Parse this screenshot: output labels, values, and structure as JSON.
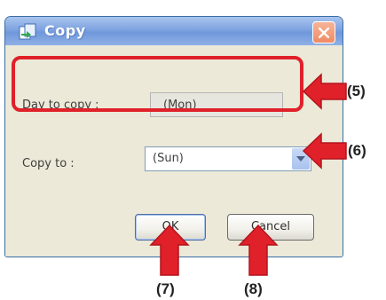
{
  "dialog": {
    "title": "Copy",
    "day_to_copy_label": "Day to copy :",
    "day_to_copy_value": "(Mon)",
    "copy_to_label": "Copy to :",
    "copy_to_value": "(Sun)",
    "ok_label": "OK",
    "cancel_label": "Cancel"
  },
  "callouts": {
    "c5": "(5)",
    "c6": "(6)",
    "c7": "(7)",
    "c8": "(8)"
  },
  "colors": {
    "highlight": "#e0212a",
    "titlebar": "#7ea3e0",
    "dialog_bg": "#ece9d8"
  }
}
